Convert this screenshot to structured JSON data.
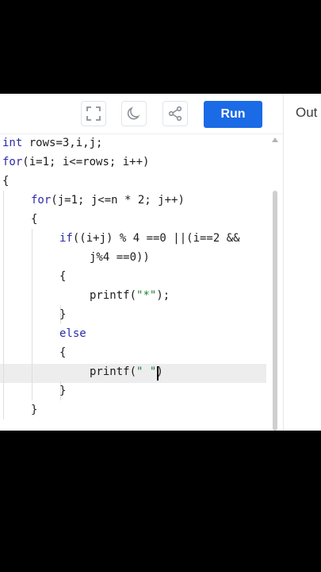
{
  "toolbar": {
    "fullscreen_icon": "fullscreen-icon",
    "theme_icon": "moon-icon",
    "share_icon": "share-icon",
    "run_label": "Run",
    "run_color": "#1b6ae6"
  },
  "output": {
    "label": "Out"
  },
  "editor": {
    "lines": [
      {
        "kw": "int",
        "rest": " rows=3,i,j;"
      },
      {
        "kw": "for",
        "rest": "(i=1; i<=rows; i++)"
      },
      {
        "kw": "",
        "rest": "{"
      },
      {
        "kw": "for",
        "rest": "(j=1; j<=n * 2; j++)"
      },
      {
        "kw": "",
        "rest": "{"
      },
      {
        "kw": "if",
        "rest": "((i+j) % 4 ==0 ||(i==2 &&"
      },
      {
        "kw": "",
        "rest": "j%4 ==0))"
      },
      {
        "kw": "",
        "rest": "{"
      },
      {
        "pre": "printf(",
        "str": "\"*\"",
        "post": ");"
      },
      {
        "kw": "",
        "rest": "}"
      },
      {
        "kw": "else",
        "rest": ""
      },
      {
        "kw": "",
        "rest": "{"
      },
      {
        "pre": "printf(",
        "str": "\" \"",
        "post": ")"
      },
      {
        "kw": "",
        "rest": "}"
      },
      {
        "kw": "",
        "rest": "}"
      }
    ]
  }
}
